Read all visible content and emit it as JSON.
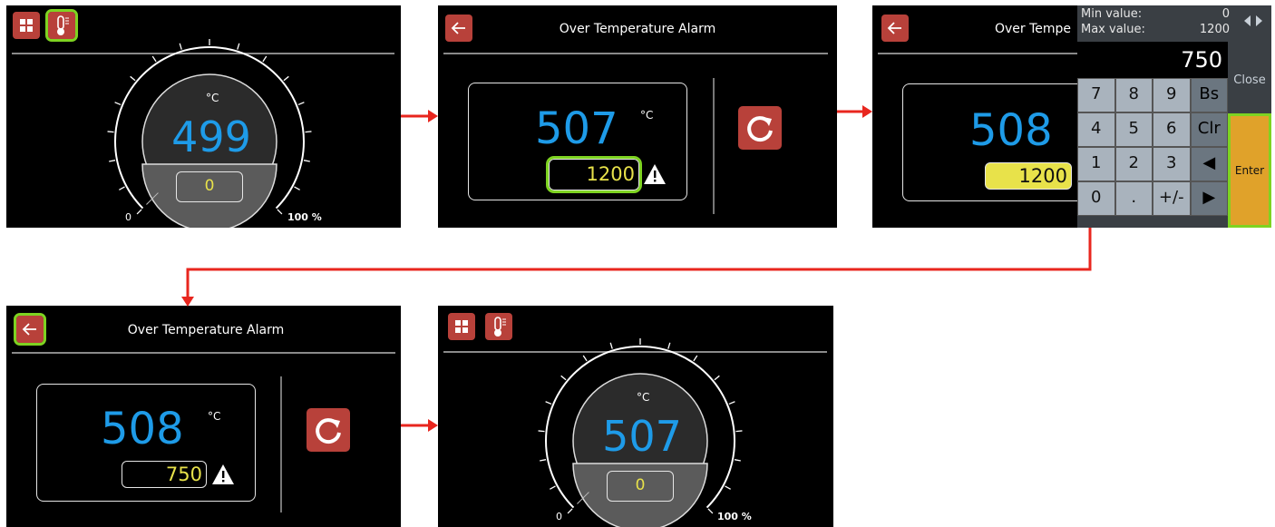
{
  "gauge_screen_1": {
    "unit": "°C",
    "temperature": "499",
    "setpoint": "0",
    "scale_min": "0",
    "scale_max": "100 %",
    "level": 0.0
  },
  "alarm_screen_1": {
    "title": "Over Temperature Alarm",
    "temperature": "507",
    "unit": "°C",
    "alarm_value": "1200"
  },
  "keypad_screen": {
    "title_partial": "Over Tempe",
    "temperature": "508",
    "alarm_value": "1200",
    "keypad": {
      "min_label": "Min value:",
      "min_value": "0",
      "max_label": "Max value:",
      "max_value": "1200",
      "entry": "750",
      "close_label": "Close",
      "enter_label": "Enter",
      "keys": [
        "7",
        "8",
        "9",
        "Bs",
        "4",
        "5",
        "6",
        "Clr",
        "1",
        "2",
        "3",
        "◀",
        "0",
        ".",
        "+/-",
        "▶"
      ]
    }
  },
  "alarm_screen_2": {
    "title": "Over Temperature Alarm",
    "temperature": "508",
    "unit": "°C",
    "alarm_value": "750"
  },
  "gauge_screen_2": {
    "unit": "°C",
    "temperature": "507",
    "setpoint": "0",
    "scale_min": "0",
    "scale_max": "100 %",
    "level": 0.0
  },
  "colors": {
    "accent_red": "#b8413a",
    "temp_blue": "#1e9be8",
    "setpoint_yellow": "#e8e24a",
    "highlight_green": "#7ed321",
    "arrow_red": "#e8261e",
    "enter_orange": "#e0a22a"
  }
}
